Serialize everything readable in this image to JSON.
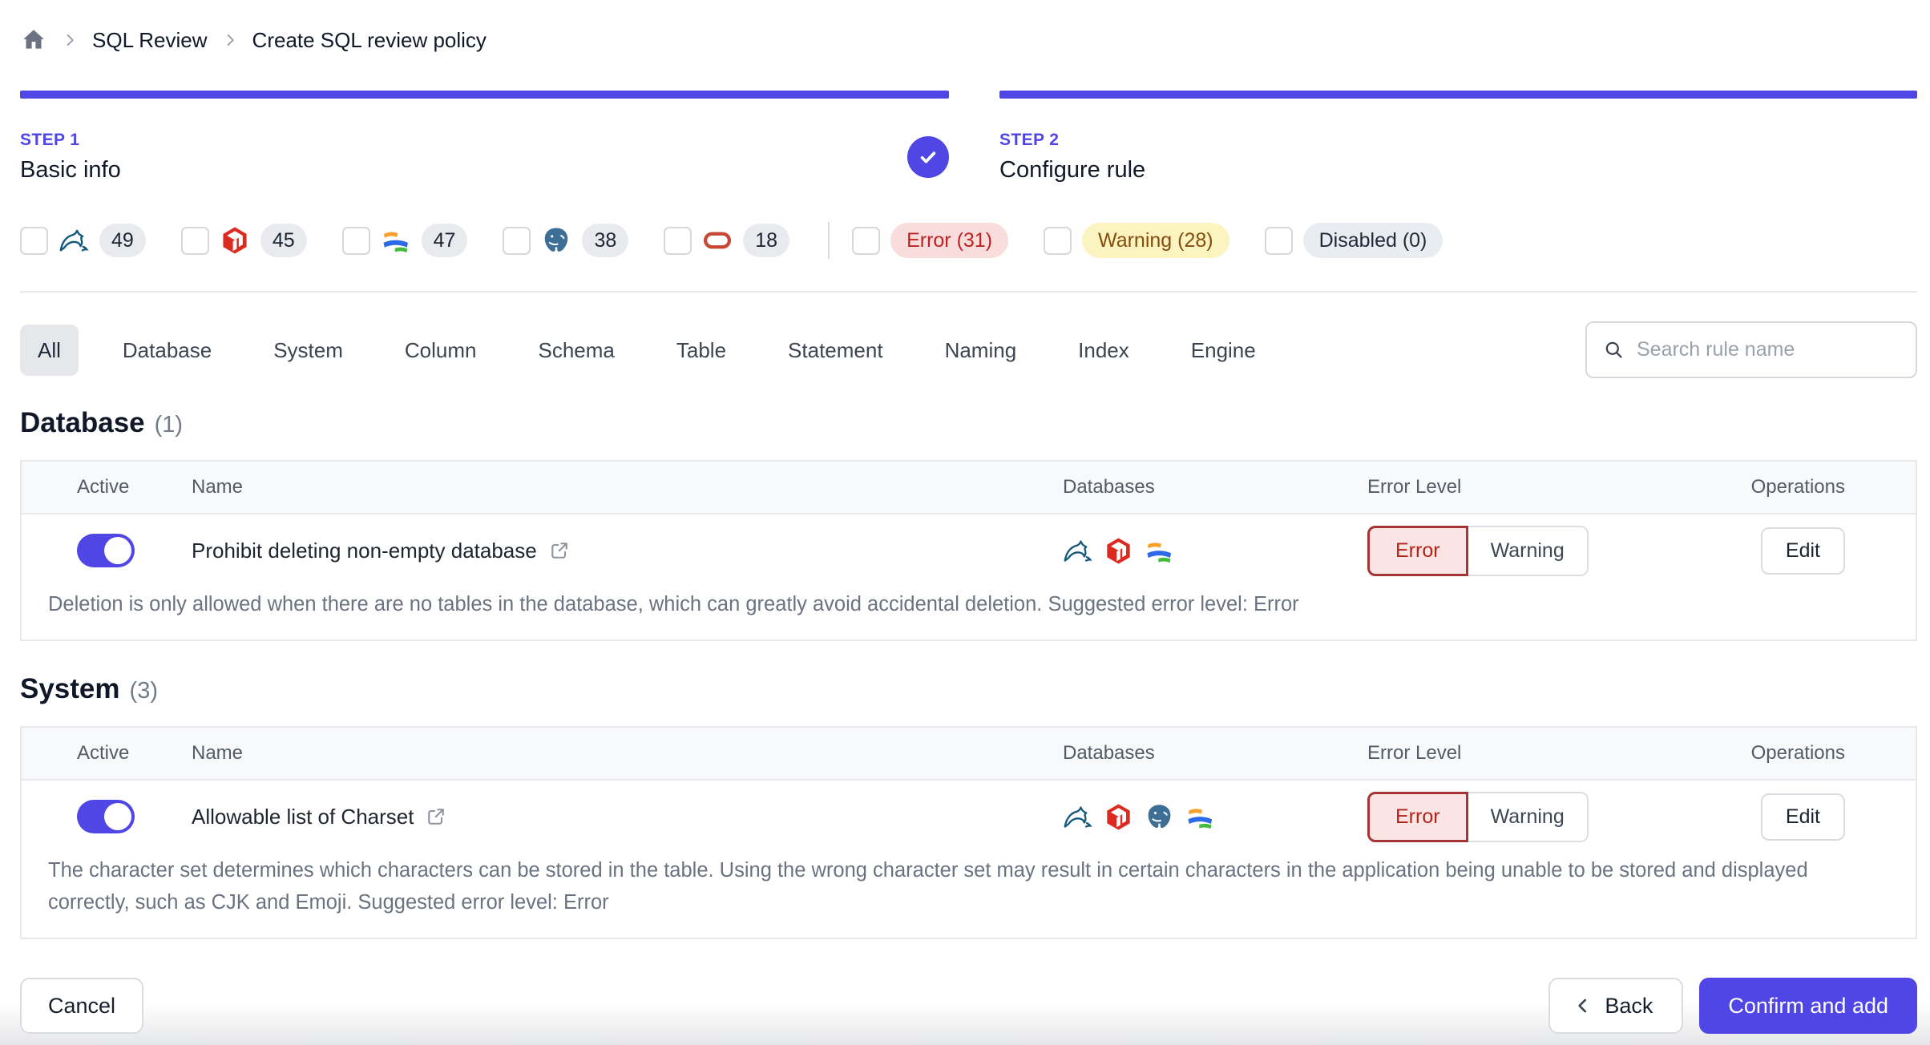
{
  "breadcrumb": {
    "items": [
      "SQL Review",
      "Create SQL review policy"
    ]
  },
  "steps": [
    {
      "label": "STEP 1",
      "title": "Basic info",
      "completed": true
    },
    {
      "label": "STEP 2",
      "title": "Configure rule",
      "completed": false
    }
  ],
  "filters": {
    "engines": [
      {
        "name": "mysql",
        "count": "49"
      },
      {
        "name": "tidb",
        "count": "45"
      },
      {
        "name": "oceanbase",
        "count": "47"
      },
      {
        "name": "postgresql",
        "count": "38"
      },
      {
        "name": "oracle",
        "count": "18"
      }
    ],
    "levels": [
      {
        "label": "Error (31)",
        "type": "error"
      },
      {
        "label": "Warning (28)",
        "type": "warning"
      },
      {
        "label": "Disabled (0)",
        "type": "disabled"
      }
    ]
  },
  "tabs": [
    {
      "label": "All",
      "active": true
    },
    {
      "label": "Database"
    },
    {
      "label": "System"
    },
    {
      "label": "Column"
    },
    {
      "label": "Schema"
    },
    {
      "label": "Table"
    },
    {
      "label": "Statement"
    },
    {
      "label": "Naming"
    },
    {
      "label": "Index"
    },
    {
      "label": "Engine"
    }
  ],
  "search": {
    "placeholder": "Search rule name"
  },
  "table_columns": {
    "active": "Active",
    "name": "Name",
    "databases": "Databases",
    "error_level": "Error Level",
    "operations": "Operations"
  },
  "level_buttons": {
    "error": "Error",
    "warning": "Warning"
  },
  "edit_label": "Edit",
  "sections": [
    {
      "title": "Database",
      "count": "(1)",
      "rules": [
        {
          "name": "Prohibit deleting non-empty database",
          "active": true,
          "engines": [
            "mysql",
            "tidb",
            "oceanbase"
          ],
          "selected_level": "Error",
          "description": "Deletion is only allowed when there are no tables in the database, which can greatly avoid accidental deletion. Suggested error level: Error"
        }
      ]
    },
    {
      "title": "System",
      "count": "(3)",
      "rules": [
        {
          "name": "Allowable list of Charset",
          "active": true,
          "engines": [
            "mysql",
            "tidb",
            "postgresql",
            "oceanbase"
          ],
          "selected_level": "Error",
          "description": "The character set determines which characters can be stored in the table. Using the wrong character set may result in certain characters in the application being unable to be stored and displayed correctly, such as CJK and Emoji. Suggested error level: Error"
        }
      ]
    }
  ],
  "footer": {
    "cancel": "Cancel",
    "back": "Back",
    "confirm": "Confirm and add"
  },
  "colors": {
    "accent": "#4f46e5",
    "error_text": "#b42318",
    "error_bg": "#fbe4e4",
    "error_border": "#a53434",
    "warning_text": "#854d0e",
    "warning_bg": "#fbf3c0",
    "disabled_bg": "#e9edf1"
  }
}
